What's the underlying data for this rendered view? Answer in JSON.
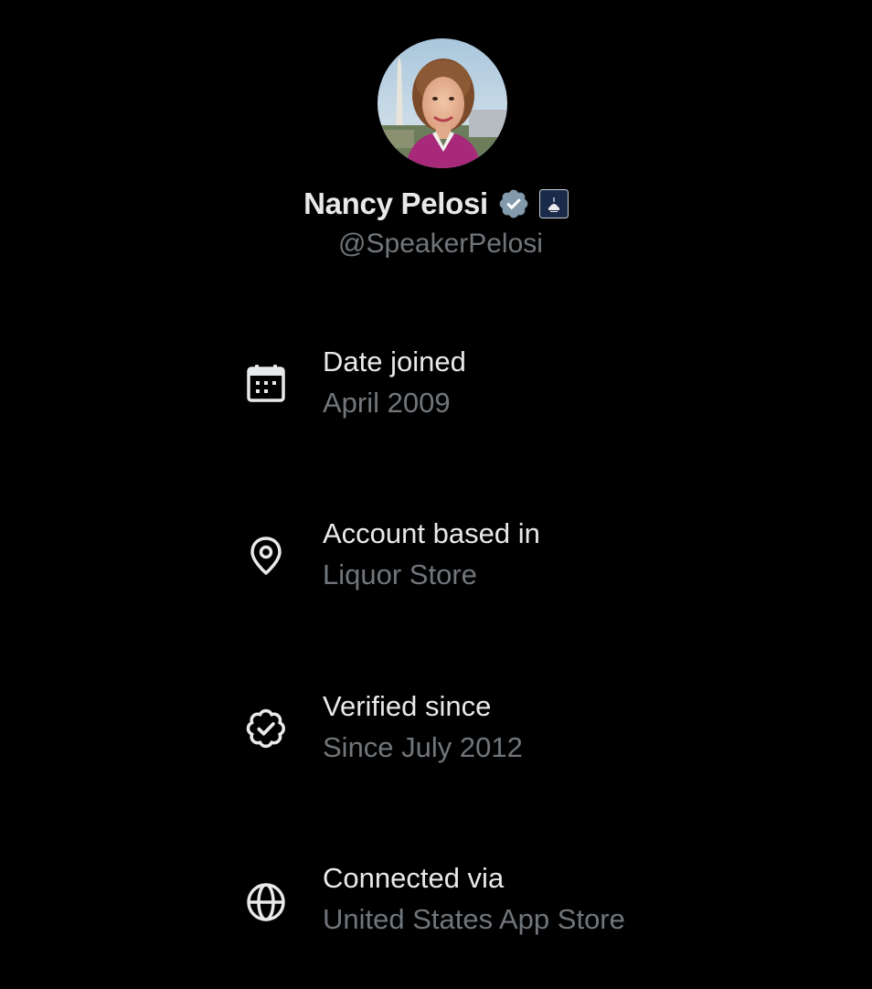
{
  "profile": {
    "display_name": "Nancy Pelosi",
    "handle": "@SpeakerPelosi",
    "verified_badge_color": "#829aab",
    "affiliate_badge_color": "#1a2a4a"
  },
  "about": {
    "items": [
      {
        "icon": "calendar-icon",
        "label": "Date joined",
        "value": "April 2009"
      },
      {
        "icon": "location-pin-icon",
        "label": "Account based in",
        "value": "Liquor Store"
      },
      {
        "icon": "verified-badge-outline-icon",
        "label": "Verified since",
        "value": "Since July 2012"
      },
      {
        "icon": "globe-icon",
        "label": "Connected via",
        "value": "United States App Store"
      }
    ]
  },
  "colors": {
    "background": "#000000",
    "primary_text": "#e7e9ea",
    "secondary_text": "#71767b"
  }
}
